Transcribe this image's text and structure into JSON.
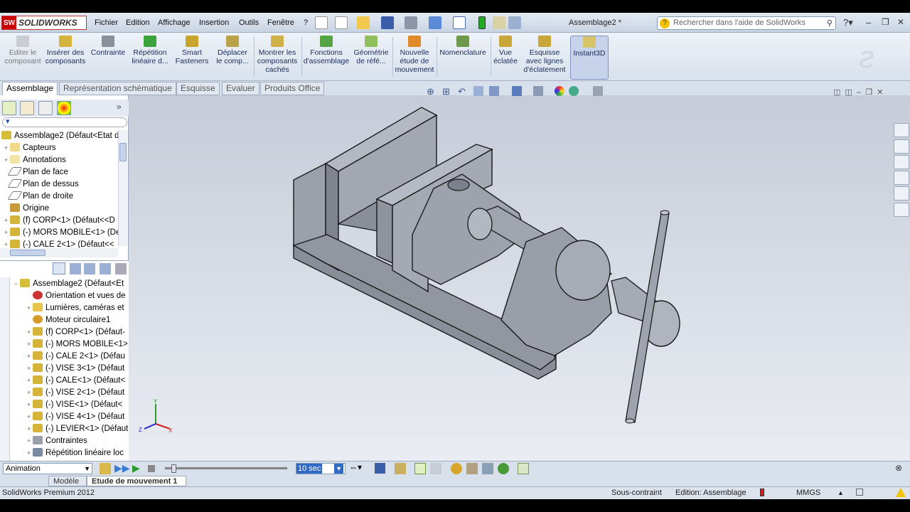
{
  "app": {
    "logo_text": "SOLIDWORKS",
    "logo_badge": "SW",
    "doc_title": "Assemblage2 *"
  },
  "menu": [
    "Fichier",
    "Edition",
    "Affichage",
    "Insertion",
    "Outils",
    "Fenêtre",
    "?"
  ],
  "search": {
    "placeholder": "Rechercher dans l'aide de SolidWorks"
  },
  "commands": [
    {
      "label": "Editer le\ncomposant",
      "disabled": true
    },
    {
      "label": "Insérer des\ncomposants",
      "disabled": false
    },
    {
      "label": "Contrainte",
      "disabled": false
    },
    {
      "label": "Répétition\nlinéaire d...",
      "disabled": false
    },
    {
      "label": "Smart\nFasteners",
      "disabled": false
    },
    {
      "label": "Déplacer\nle comp...",
      "disabled": false
    },
    {
      "label": "Montrer les\ncomposants\ncachés",
      "disabled": false
    },
    {
      "label": "Fonctions\nd'assemblage",
      "disabled": false
    },
    {
      "label": "Géométrie\nde réfé...",
      "disabled": false
    },
    {
      "label": "Nouvelle\nétude de\nmouvement",
      "disabled": false
    },
    {
      "label": "Nomenclature",
      "disabled": false
    },
    {
      "label": "Vue\néclatée",
      "disabled": false
    },
    {
      "label": "Esquisse\navec lignes\nd'éclatement",
      "disabled": false
    },
    {
      "label": "Instant3D",
      "active": true
    }
  ],
  "tabs": [
    "Assemblage",
    "Représentation schématique",
    "Esquisse",
    "Evaluer",
    "Produits Office"
  ],
  "tree_top": [
    "Assemblage2  (Défaut<Etat d",
    "Capteurs",
    "Annotations",
    "Plan de face",
    "Plan de dessus",
    "Plan de droite",
    "Origine",
    "(f) CORP<1> (Défaut<<D",
    "(-) MORS MOBILE<1> (De",
    "(-) CALE 2<1> (Défaut<<"
  ],
  "tree_bottom": [
    "Assemblage2  (Défaut<Et",
    "Orientation et vues de",
    "Lumières, caméras et",
    "Moteur circulaire1",
    "(f) CORP<1> (Défaut-",
    "(-) MORS MOBILE<1>",
    "(-) CALE 2<1> (Défau",
    "(-) VISE 3<1> (Défaut",
    "(-) CALE<1> (Défaut<",
    "(-) VISE 2<1> (Défaut",
    "(-) VISE<1> (Défaut<",
    "(-) VISE 4<1> (Défaut",
    "(-) LEVIER<1> (Défaut",
    "Contraintes",
    "Répétition linéaire loc"
  ],
  "animation": {
    "type": "Animation",
    "time": "10 sec"
  },
  "bottom_tabs": [
    "Modèle",
    "Etude de mouvement 1"
  ],
  "status": {
    "product": "SolidWorks Premium 2012",
    "constraint": "Sous-contraint",
    "mode": "Edition: Assemblage",
    "units": "MMGS"
  },
  "triad": {
    "x": "X",
    "y": "Y",
    "z": "Z"
  }
}
